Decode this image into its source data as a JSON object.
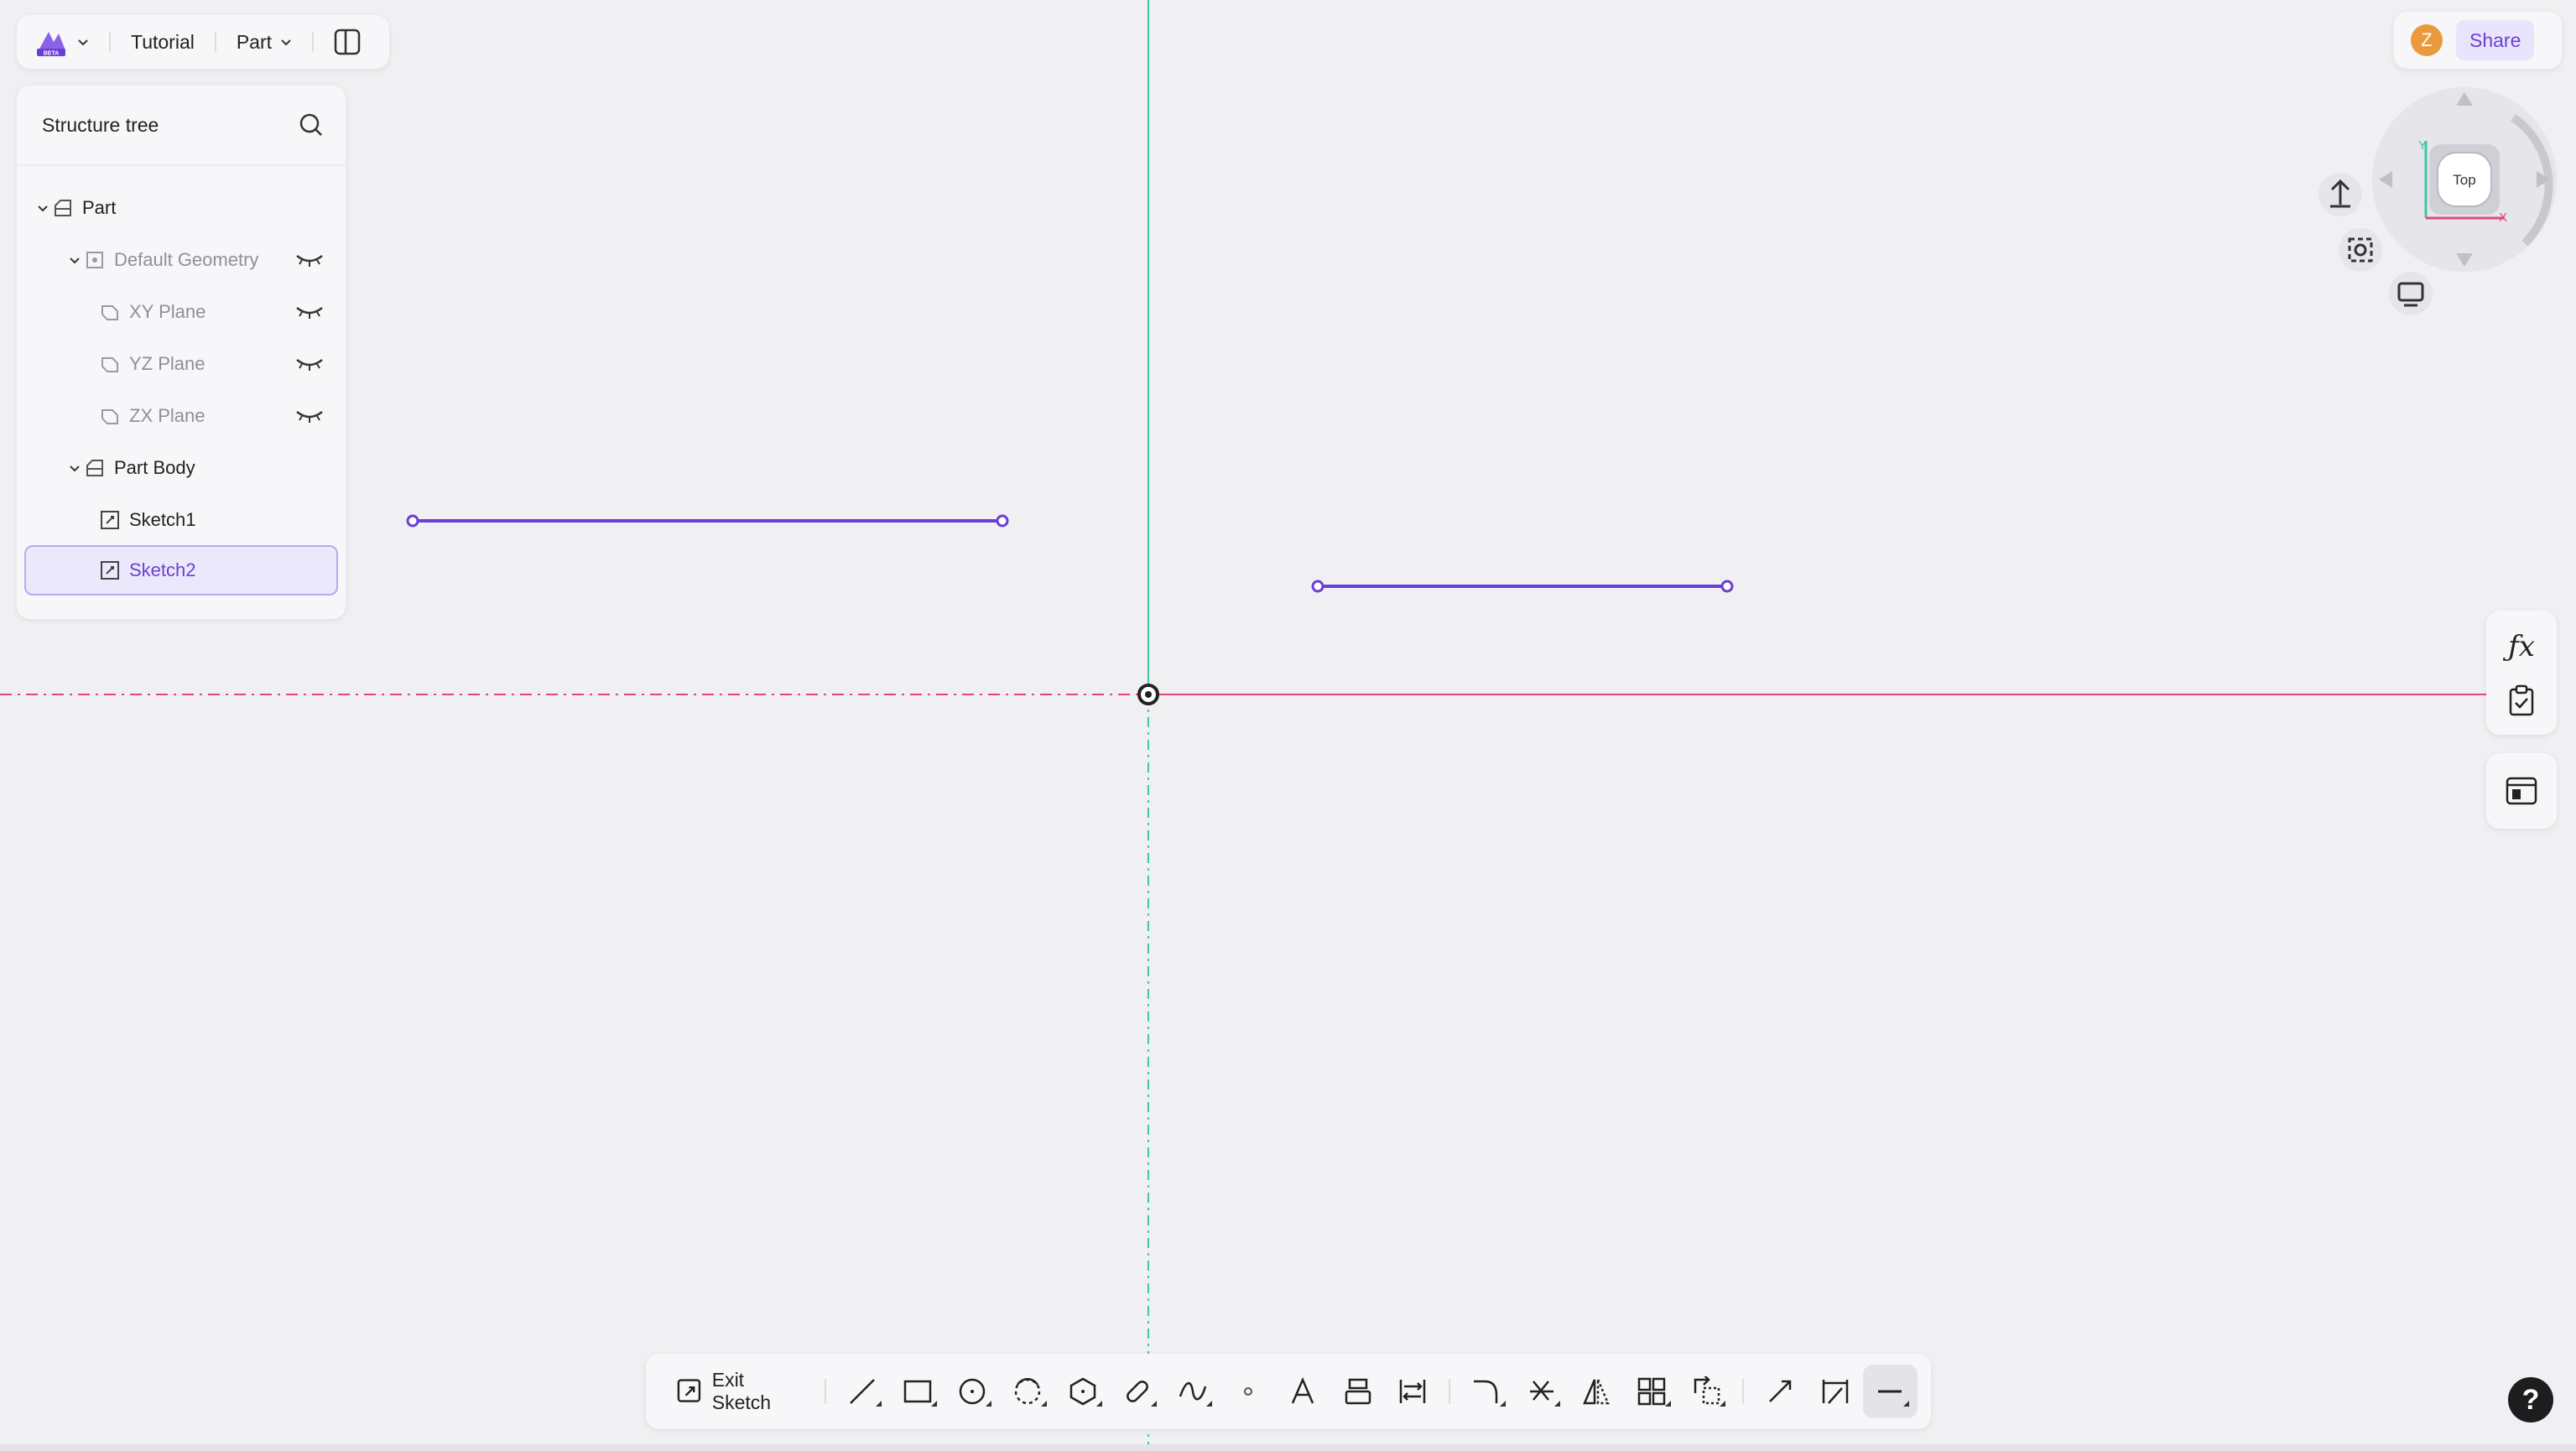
{
  "topbar": {
    "logo_badge": "BETA",
    "project": "Tutorial",
    "mode": "Part"
  },
  "tree": {
    "title": "Structure tree",
    "items": [
      {
        "label": "Part"
      },
      {
        "label": "Default Geometry"
      },
      {
        "label": "XY Plane"
      },
      {
        "label": "YZ Plane"
      },
      {
        "label": "ZX Plane"
      },
      {
        "label": "Part Body"
      },
      {
        "label": "Sketch1"
      },
      {
        "label": "Sketch2"
      }
    ]
  },
  "header_right": {
    "avatar_letter": "Z",
    "share_label": "Share"
  },
  "view_cube": {
    "face_label": "Top",
    "axis_x": "X",
    "axis_y": "Y"
  },
  "toolbar": {
    "exit_label": "Exit Sketch"
  },
  "help": {
    "label": "?"
  },
  "colors": {
    "accent": "#6a3fd6",
    "sketch_line": "#6a3fd6",
    "axis_vertical": "#3ec7a8",
    "axis_horizontal": "#e0457b",
    "background": "#f0f0f2"
  }
}
